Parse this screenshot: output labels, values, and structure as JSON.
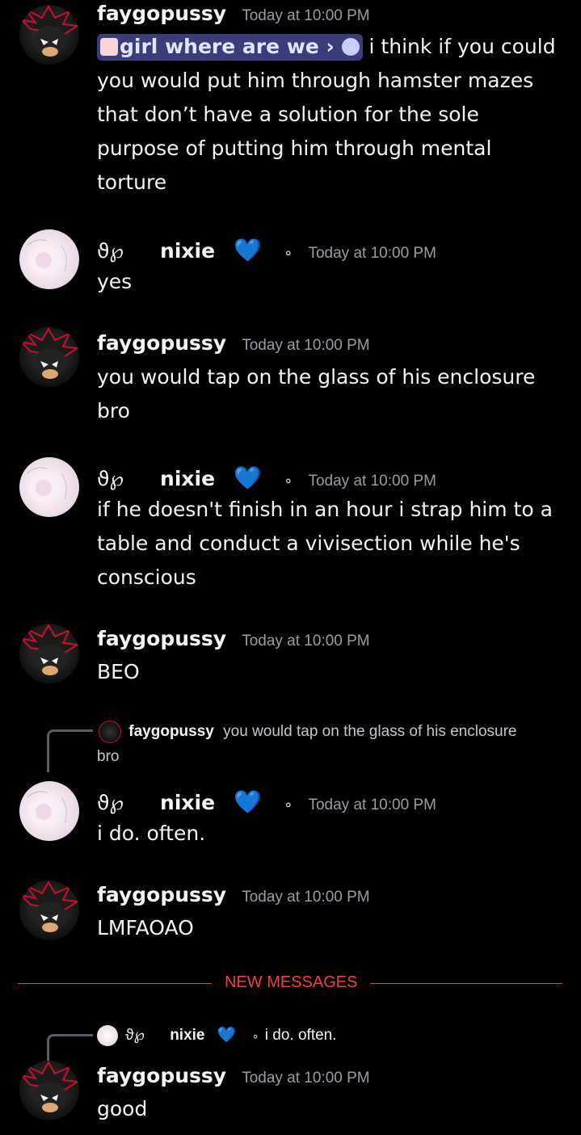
{
  "messages": [
    {
      "user": "faygopussy",
      "time": "Today at 10:00 PM",
      "channel_pill": "girl where are we",
      "text": "i think if you could you would put him through hamster mazes that don’t have a solution for the sole purpose of putting him through mental torture"
    },
    {
      "user": "nixie",
      "prefix": "ϑ℘",
      "time": "Today at 10:00 PM",
      "text": "yes"
    },
    {
      "user": "faygopussy",
      "time": "Today at 10:00 PM",
      "text": "you would tap on the glass of his enclosure bro"
    },
    {
      "user": "nixie",
      "prefix": "ϑ℘",
      "time": "Today at 10:00 PM",
      "text": "if he doesn't finish in an hour i strap him to a table and conduct a vivisection while he's conscious"
    },
    {
      "user": "faygopussy",
      "time": "Today at 10:00 PM",
      "text": "BEO"
    },
    {
      "user": "nixie",
      "prefix": "ϑ℘",
      "time": "Today at 10:00 PM",
      "text": "i do. often.",
      "reply": {
        "user": "faygopussy",
        "text": "you would tap on the glass of his enclosure",
        "wrap": "bro"
      }
    },
    {
      "user": "faygopussy",
      "time": "Today at 10:00 PM",
      "text": "LMFAOAO"
    },
    {
      "user": "faygopussy",
      "time": "Today at 10:00 PM",
      "text": "good",
      "reply": {
        "prefix": "ϑ℘",
        "user": "nixie",
        "text": "i do. often."
      }
    }
  ],
  "divider": "NEW MESSAGES",
  "icons": {
    "heart": "💙",
    "dot": "∘",
    "chevron": "›",
    "bubble": "chat-bubble-icon"
  },
  "colors": {
    "heart": "#3aa8ff",
    "divider": "#f23f42",
    "pill": "#3b3d7a"
  }
}
